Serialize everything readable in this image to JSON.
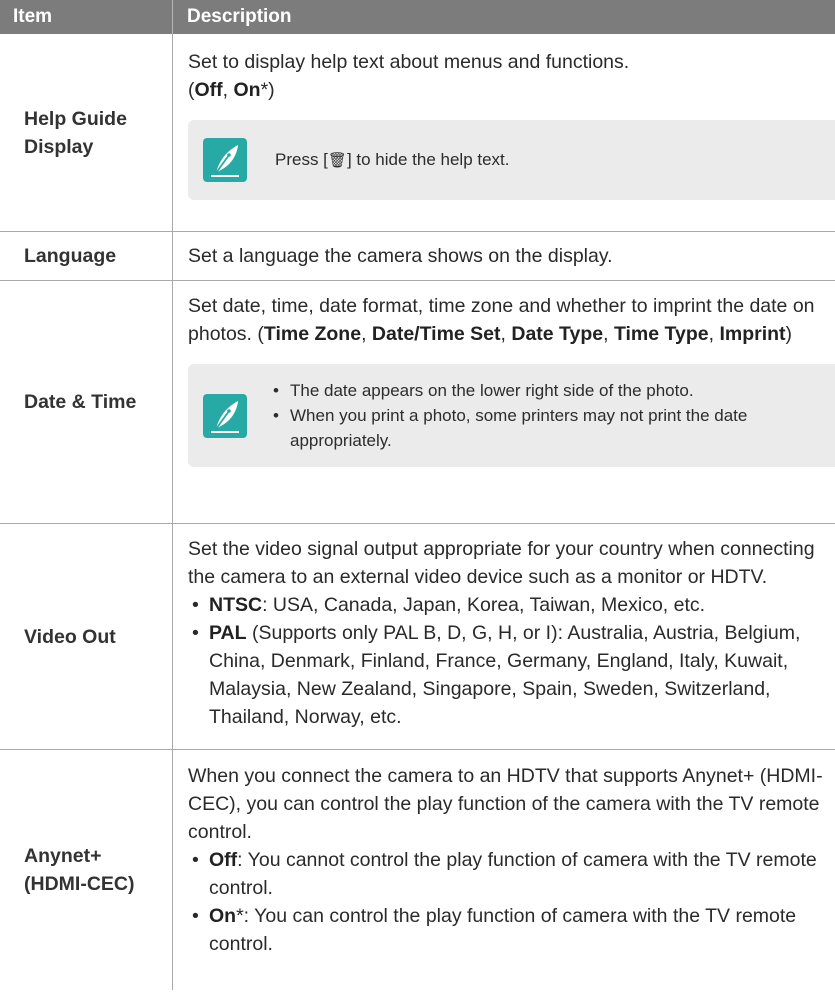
{
  "header": {
    "item": "Item",
    "description": "Description"
  },
  "colors": {
    "header_bg": "#7c7c7c",
    "note_bg": "#ebebeb",
    "note_icon": "#27a9a6",
    "divider": "#a8a8a8"
  },
  "rows": [
    {
      "item_line1": "Help Guide",
      "item_line2": "Display",
      "desc_text": "Set to display help text about menus and functions.",
      "opt_open": "(",
      "opt1": "Off",
      "sep": ", ",
      "opt2": "On",
      "opt_close": "*)",
      "note_prefix": "Press [",
      "note_icon_name": "trash-icon",
      "note_suffix": "] to hide the help text."
    },
    {
      "item": "Language",
      "desc_text": "Set a language the camera shows on the display."
    },
    {
      "item": "Date & Time",
      "desc_text": "Set date, time, date format, time zone and whether to imprint the date on photos. (",
      "opts": [
        "Time Zone",
        "Date/Time Set",
        "Date Type",
        "Time Type",
        "Imprint"
      ],
      "sep": ", ",
      "close": ")",
      "notes": [
        "The date appears on the lower right side of the photo.",
        "When you print a photo, some printers may not print the date appropriately."
      ]
    },
    {
      "item": "Video Out",
      "desc_text": "Set the video signal output appropriate for your country when connecting the camera to an external video device such as a monitor or HDTV.",
      "bullets": [
        {
          "term": "NTSC",
          "text": ": USA, Canada, Japan, Korea, Taiwan, Mexico, etc."
        },
        {
          "term": "PAL",
          "text": " (Supports only PAL B, D, G, H, or I): Australia, Austria, Belgium, China, Denmark, Finland, France, Germany, England, Italy, Kuwait, Malaysia, New Zealand, Singapore, Spain, Sweden, Switzerland, Thailand, Norway, etc."
        }
      ]
    },
    {
      "item_line1": "Anynet+",
      "item_line2": "(HDMI-CEC)",
      "desc_text": "When you connect the camera to an HDTV that supports Anynet+ (HDMI-CEC), you can control the play function of the camera with the TV remote control.",
      "bullets": [
        {
          "term": "Off",
          "text": ": You cannot control the play function of camera with the TV remote control."
        },
        {
          "term": "On",
          "text": "*: You can control the play function of camera with the TV remote control."
        }
      ]
    }
  ]
}
